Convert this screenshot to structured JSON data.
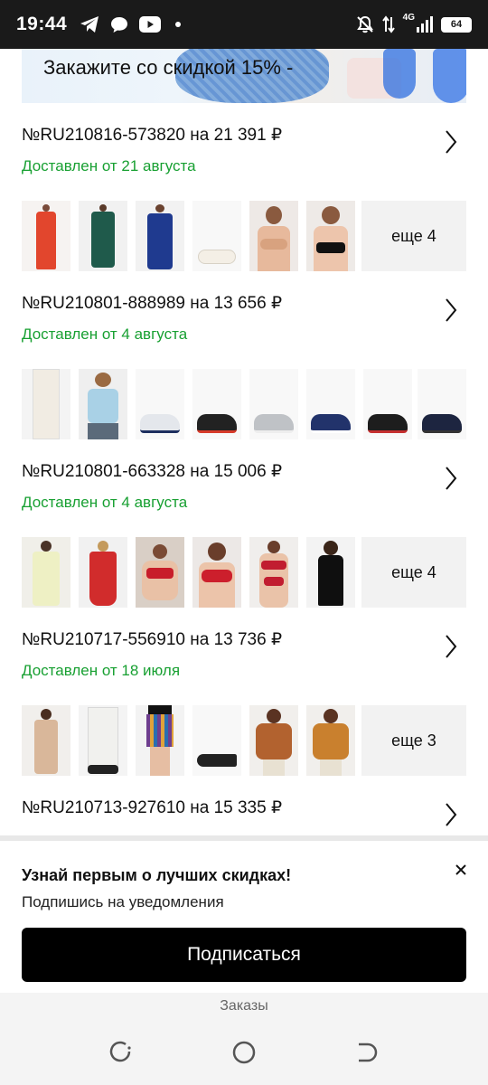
{
  "status_bar": {
    "time": "19:44",
    "network": "4G",
    "battery": "64"
  },
  "banner": {
    "text": "Закажите со скидкой 15%  -"
  },
  "orders": [
    {
      "title": "№RU210816-573820 на 21 391 ₽",
      "status": "Доставлен от 21 августа",
      "more": "еще 4"
    },
    {
      "title": "№RU210801-888989 на 13 656 ₽",
      "status": "Доставлен от 4 августа",
      "more": ""
    },
    {
      "title": "№RU210801-663328 на 15 006 ₽",
      "status": "Доставлен от 4 августа",
      "more": "еще 4"
    },
    {
      "title": "№RU210717-556910 на 13 736 ₽",
      "status": "Доставлен от 18 июля",
      "more": "еще 3"
    },
    {
      "title": "№RU210713-927610 на 15 335 ₽"
    }
  ],
  "popup": {
    "title": "Узнай первым о лучших скидках!",
    "subtitle": "Подпишись на уведомления",
    "button": "Подписаться"
  },
  "bottom": {
    "label": "Заказы"
  }
}
